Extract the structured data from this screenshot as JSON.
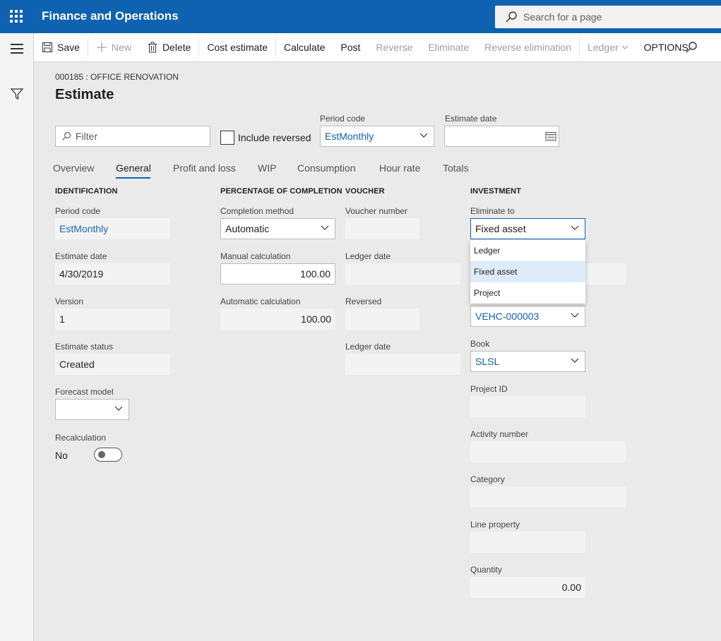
{
  "app": {
    "title": "Finance and Operations",
    "search_placeholder": "Search for a page"
  },
  "actions": {
    "save": "Save",
    "new": "New",
    "delete": "Delete",
    "cost_estimate": "Cost estimate",
    "calculate": "Calculate",
    "post": "Post",
    "reverse": "Reverse",
    "eliminate": "Eliminate",
    "reverse_elimination": "Reverse elimination",
    "ledger": "Ledger",
    "options": "OPTIONS"
  },
  "page": {
    "caption": "000185 : OFFICE RENOVATION",
    "title": "Estimate"
  },
  "filters": {
    "filter_placeholder": "Filter",
    "include_reversed": "Include reversed",
    "period_code_label": "Period code",
    "period_code_value": "EstMonthly",
    "estimate_date_label": "Estimate date",
    "estimate_date_value": ""
  },
  "tabs": [
    "Overview",
    "General",
    "Profit and loss",
    "WIP",
    "Consumption",
    "Hour rate",
    "Totals"
  ],
  "identification": {
    "header": "IDENTIFICATION",
    "period_code_label": "Period code",
    "period_code": "EstMonthly",
    "estimate_date_label": "Estimate date",
    "estimate_date": "4/30/2019",
    "version_label": "Version",
    "version": "1",
    "status_label": "Estimate status",
    "status": "Created",
    "forecast_label": "Forecast model",
    "forecast": "",
    "recalc_label": "Recalculation",
    "recalc": "No"
  },
  "completion": {
    "header": "PERCENTAGE OF COMPLETION",
    "method_label": "Completion method",
    "method": "Automatic",
    "manual_label": "Manual calculation",
    "manual": "100.00",
    "auto_label": "Automatic calculation",
    "auto": "100.00"
  },
  "voucher": {
    "header": "VOUCHER",
    "number_label": "Voucher number",
    "ledger_date_label": "Ledger date",
    "reversed_label": "Reversed",
    "ledger_date2_label": "Ledger date"
  },
  "investment": {
    "header": "INVESTMENT",
    "eliminate_label": "Eliminate to",
    "eliminate": "Fixed asset",
    "options": [
      "Ledger",
      "Fixed asset",
      "Project"
    ],
    "asset": "VEHC-000003",
    "book_label": "Book",
    "book": "SLSL",
    "project_label": "Project ID",
    "activity_label": "Activity number",
    "category_label": "Category",
    "line_property_label": "Line property",
    "quantity_label": "Quantity",
    "quantity": "0.00"
  }
}
